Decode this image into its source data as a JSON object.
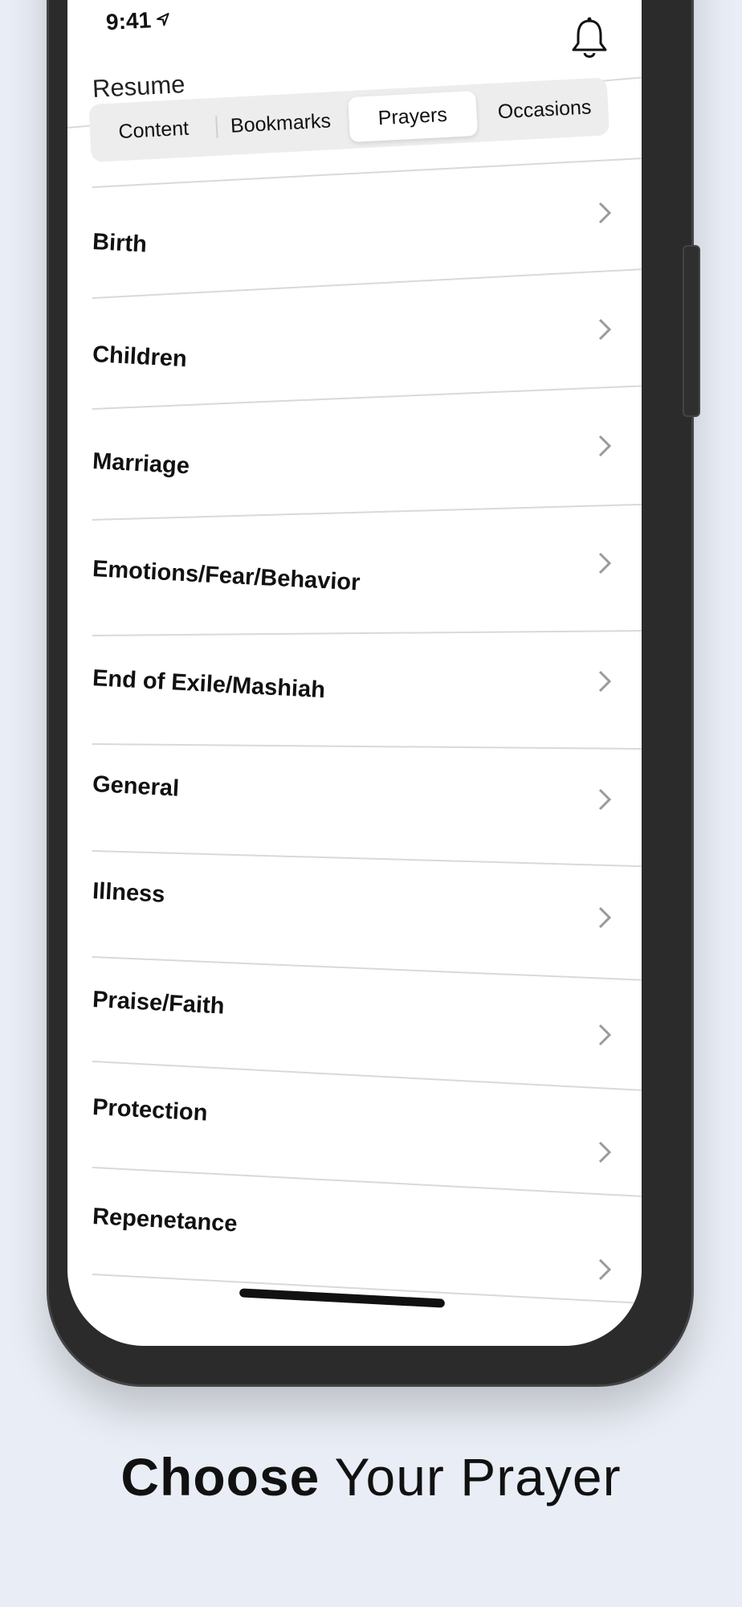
{
  "status_bar": {
    "time": "9:41"
  },
  "header": {
    "resume_label": "Resume",
    "notifications_icon": "bell-icon"
  },
  "tabs": [
    {
      "label": "Content",
      "active": false
    },
    {
      "label": "Bookmarks",
      "active": false
    },
    {
      "label": "Prayers",
      "active": true
    },
    {
      "label": "Occasions",
      "active": false
    }
  ],
  "categories": [
    {
      "label": "Birth"
    },
    {
      "label": "Children"
    },
    {
      "label": "Marriage"
    },
    {
      "label": "Emotions/Fear/Behavior"
    },
    {
      "label": "End of Exile/Mashiah"
    },
    {
      "label": "General"
    },
    {
      "label": "Illness"
    },
    {
      "label": "Praise/Faith"
    },
    {
      "label": "Protection"
    },
    {
      "label": "Repenetance"
    }
  ],
  "caption": {
    "bold": "Choose",
    "rest": " Your Prayer"
  },
  "colors": {
    "background": "#e9edf5",
    "frame": "#2b2b2b",
    "accent": "#111111"
  }
}
